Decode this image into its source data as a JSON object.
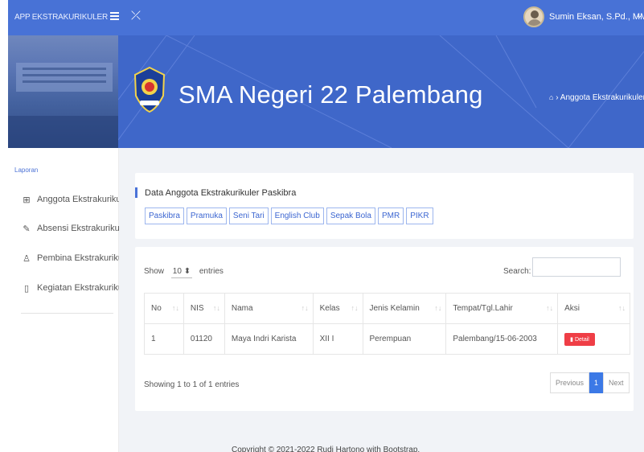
{
  "app": {
    "brand": "APP EKSTRAKURIKULER",
    "user_name": "Sumin Eksan, S.Pd., MM"
  },
  "banner": {
    "school_title": "SMA Negeri 22 Palembang",
    "breadcrumb": "Anggota Ekstrakurikuler"
  },
  "sidebar": {
    "heading": "Laporan",
    "items": [
      {
        "label": "Anggota Ekstrakurikuler",
        "icon": "table-icon"
      },
      {
        "label": "Absensi Ekstrakurikuler",
        "icon": "edit-icon"
      },
      {
        "label": "Pembina Ekstrakurikuler",
        "icon": "user-icon"
      },
      {
        "label": "Kegiatan Ekstrakurikuler",
        "icon": "file-icon"
      }
    ]
  },
  "panel": {
    "title": "Data Anggota Ekstrakurikuler Paskibra",
    "tabs": [
      "Paskibra",
      "Pramuka",
      "Seni Tari",
      "English Club",
      "Sepak Bola",
      "PMR",
      "PIKR"
    ]
  },
  "table": {
    "show_label": "Show",
    "page_length": "10",
    "entries_label": "entries",
    "search_label": "Search:",
    "search_value": "",
    "columns": [
      "No",
      "NIS",
      "Nama",
      "Kelas",
      "Jenis Kelamin",
      "Tempat/Tgl.Lahir",
      "Aksi"
    ],
    "rows": [
      {
        "no": "1",
        "nis": "01120",
        "nama": "Maya Indri Karista",
        "kelas": "XII I",
        "jenis_kelamin": "Perempuan",
        "ttl": "Palembang/15-06-2003",
        "action": "Detail"
      }
    ],
    "showing": "Showing 1 to 1 of 1 entries",
    "pagination": {
      "previous": "Previous",
      "current": "1",
      "next": "Next"
    }
  },
  "footer": "Copyright © 2021-2022 Rudi Hartono with Bootstrap.",
  "colors": {
    "primary": "#4872d6",
    "banner": "#3f67c9",
    "danger": "#ef3e46",
    "page_bg": "#f1f3f7"
  }
}
